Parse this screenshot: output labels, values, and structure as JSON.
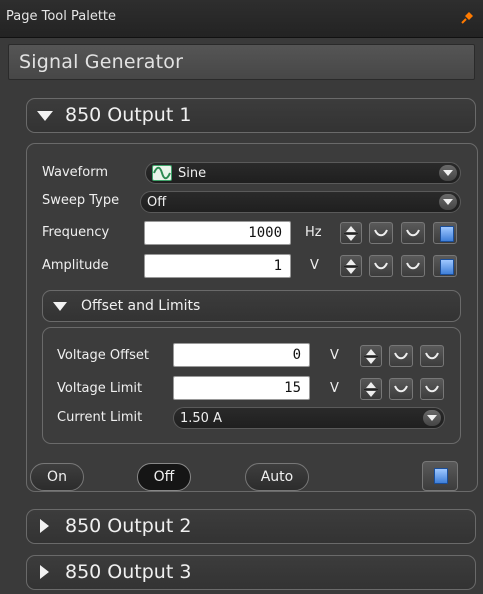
{
  "window": {
    "title": "Page Tool Palette"
  },
  "palette": {
    "title": "Signal Generator"
  },
  "sections": [
    {
      "label": "850 Output 1",
      "expanded": true
    },
    {
      "label": "850 Output 2",
      "expanded": false
    },
    {
      "label": "850 Output 3",
      "expanded": false
    }
  ],
  "waveform": {
    "label": "Waveform",
    "value": "Sine"
  },
  "sweep": {
    "label": "Sweep Type",
    "value": "Off"
  },
  "frequency": {
    "label": "Frequency",
    "value": "1000",
    "unit": "Hz"
  },
  "amplitude": {
    "label": "Amplitude",
    "value": "1",
    "unit": "V"
  },
  "offset_limits": {
    "label": "Offset and Limits",
    "voltage_offset": {
      "label": "Voltage Offset",
      "value": "0",
      "unit": "V"
    },
    "voltage_limit": {
      "label": "Voltage Limit",
      "value": "15",
      "unit": "V"
    },
    "current_limit": {
      "label": "Current Limit",
      "value": "1.50 A"
    }
  },
  "buttons": {
    "on": "On",
    "off": "Off",
    "auto": "Auto",
    "active": "off"
  },
  "icons": {
    "pin": "pin-icon",
    "sine": "sine-wave-icon",
    "spinner": "spinner-icon",
    "wave_up": "wave-up-icon",
    "wave_down": "wave-down-icon",
    "calculator": "calculator-icon",
    "triangle_down": "triangle-down-icon",
    "triangle_right": "triangle-right-icon"
  },
  "colors": {
    "accent_blue": "#3f7fd8",
    "pin": "#ff7a00",
    "sine_icon": "#3fa36a"
  }
}
